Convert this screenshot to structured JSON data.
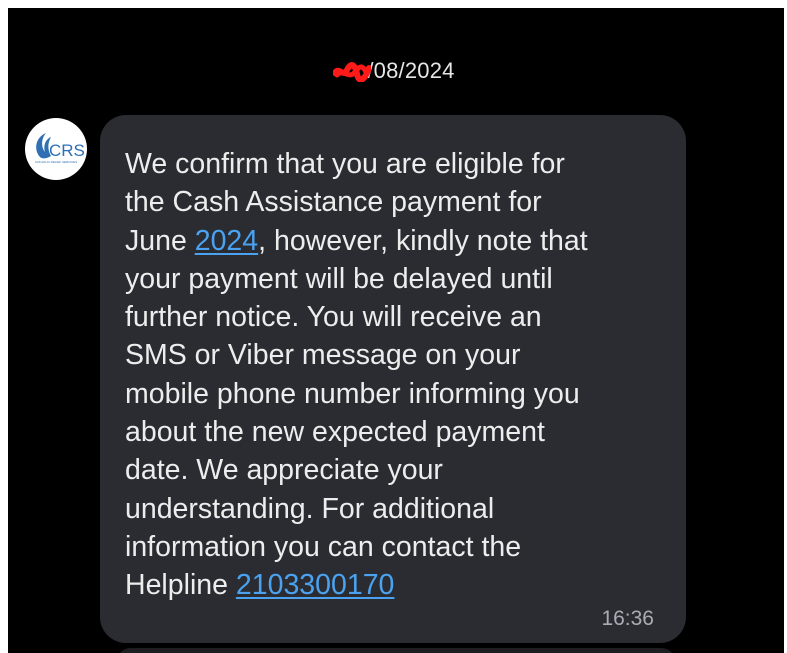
{
  "conversation": {
    "date_separator": "/08/2024"
  },
  "sender": {
    "avatar_logo_text": "CRS",
    "avatar_logo_subtext": "CATHOLIC RELIEF SERVICES"
  },
  "message": {
    "text_part1": "We confirm that you are eligible for\nthe Cash Assistance payment for\nJune ",
    "link_year": "2024",
    "text_part2": ", however, kindly note that\nyour payment will be delayed until\nfurther notice. You will receive an\nSMS or Viber message on your\nmobile phone number informing you\nabout the new expected payment\ndate. We appreciate your\nunderstanding. For additional\ninformation you can contact the\nHelpline ",
    "link_phone": "2103300170",
    "timestamp": "16:36"
  },
  "colors": {
    "background": "#000000",
    "bubble": "#2a2c31",
    "link": "#4aa2f0",
    "text": "#ededed",
    "redaction": "#ff1a1a"
  }
}
